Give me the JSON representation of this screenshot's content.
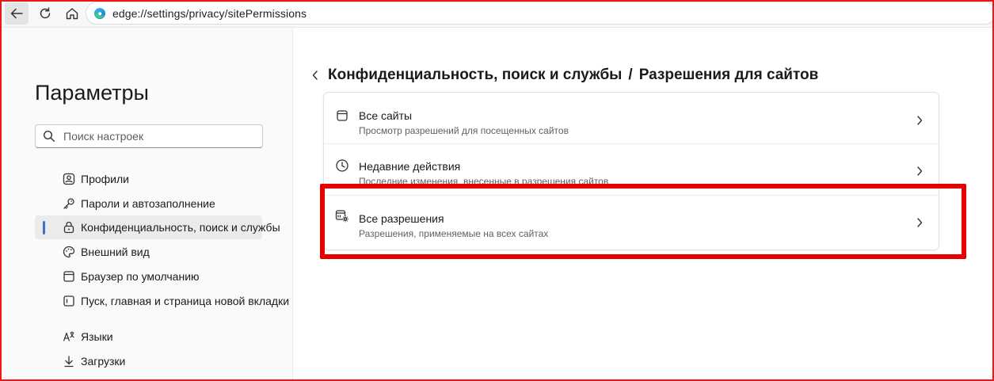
{
  "address_bar": {
    "url": "edge://settings/privacy/sitePermissions"
  },
  "sidebar": {
    "title": "Параметры",
    "search_placeholder": "Поиск настроек",
    "items": [
      {
        "label": "Профили",
        "icon": "profile-icon",
        "active": false
      },
      {
        "label": "Пароли и автозаполнение",
        "icon": "key-icon",
        "active": false
      },
      {
        "label": "Конфиденциальность, поиск и службы",
        "icon": "lock-icon",
        "active": true
      },
      {
        "label": "Внешний вид",
        "icon": "palette-icon",
        "active": false
      },
      {
        "label": "Браузер по умолчанию",
        "icon": "browser-window-icon",
        "active": false
      },
      {
        "label": "Пуск, главная и страница новой вкладки",
        "icon": "home-page-icon",
        "active": false
      },
      {
        "label": "Языки",
        "icon": "language-icon",
        "active": false
      },
      {
        "label": "Загрузки",
        "icon": "download-icon",
        "active": false
      }
    ]
  },
  "breadcrumb": {
    "parent": "Конфиденциальность, поиск и службы",
    "separator": "/",
    "current": "Разрешения для сайтов"
  },
  "permissions_list": [
    {
      "title": "Все сайты",
      "subtitle": "Просмотр разрешений для посещенных сайтов",
      "icon": "all-sites-icon"
    },
    {
      "title": "Недавние действия",
      "subtitle": "Последние изменения, внесенные в разрешения сайтов",
      "icon": "clock-icon"
    },
    {
      "title": "Все разрешения",
      "subtitle": "Разрешения, применяемые на всех сайтах",
      "icon": "permissions-gear-icon"
    }
  ],
  "colors": {
    "highlight": "#e60000",
    "active_accent": "#3b6fd0"
  }
}
